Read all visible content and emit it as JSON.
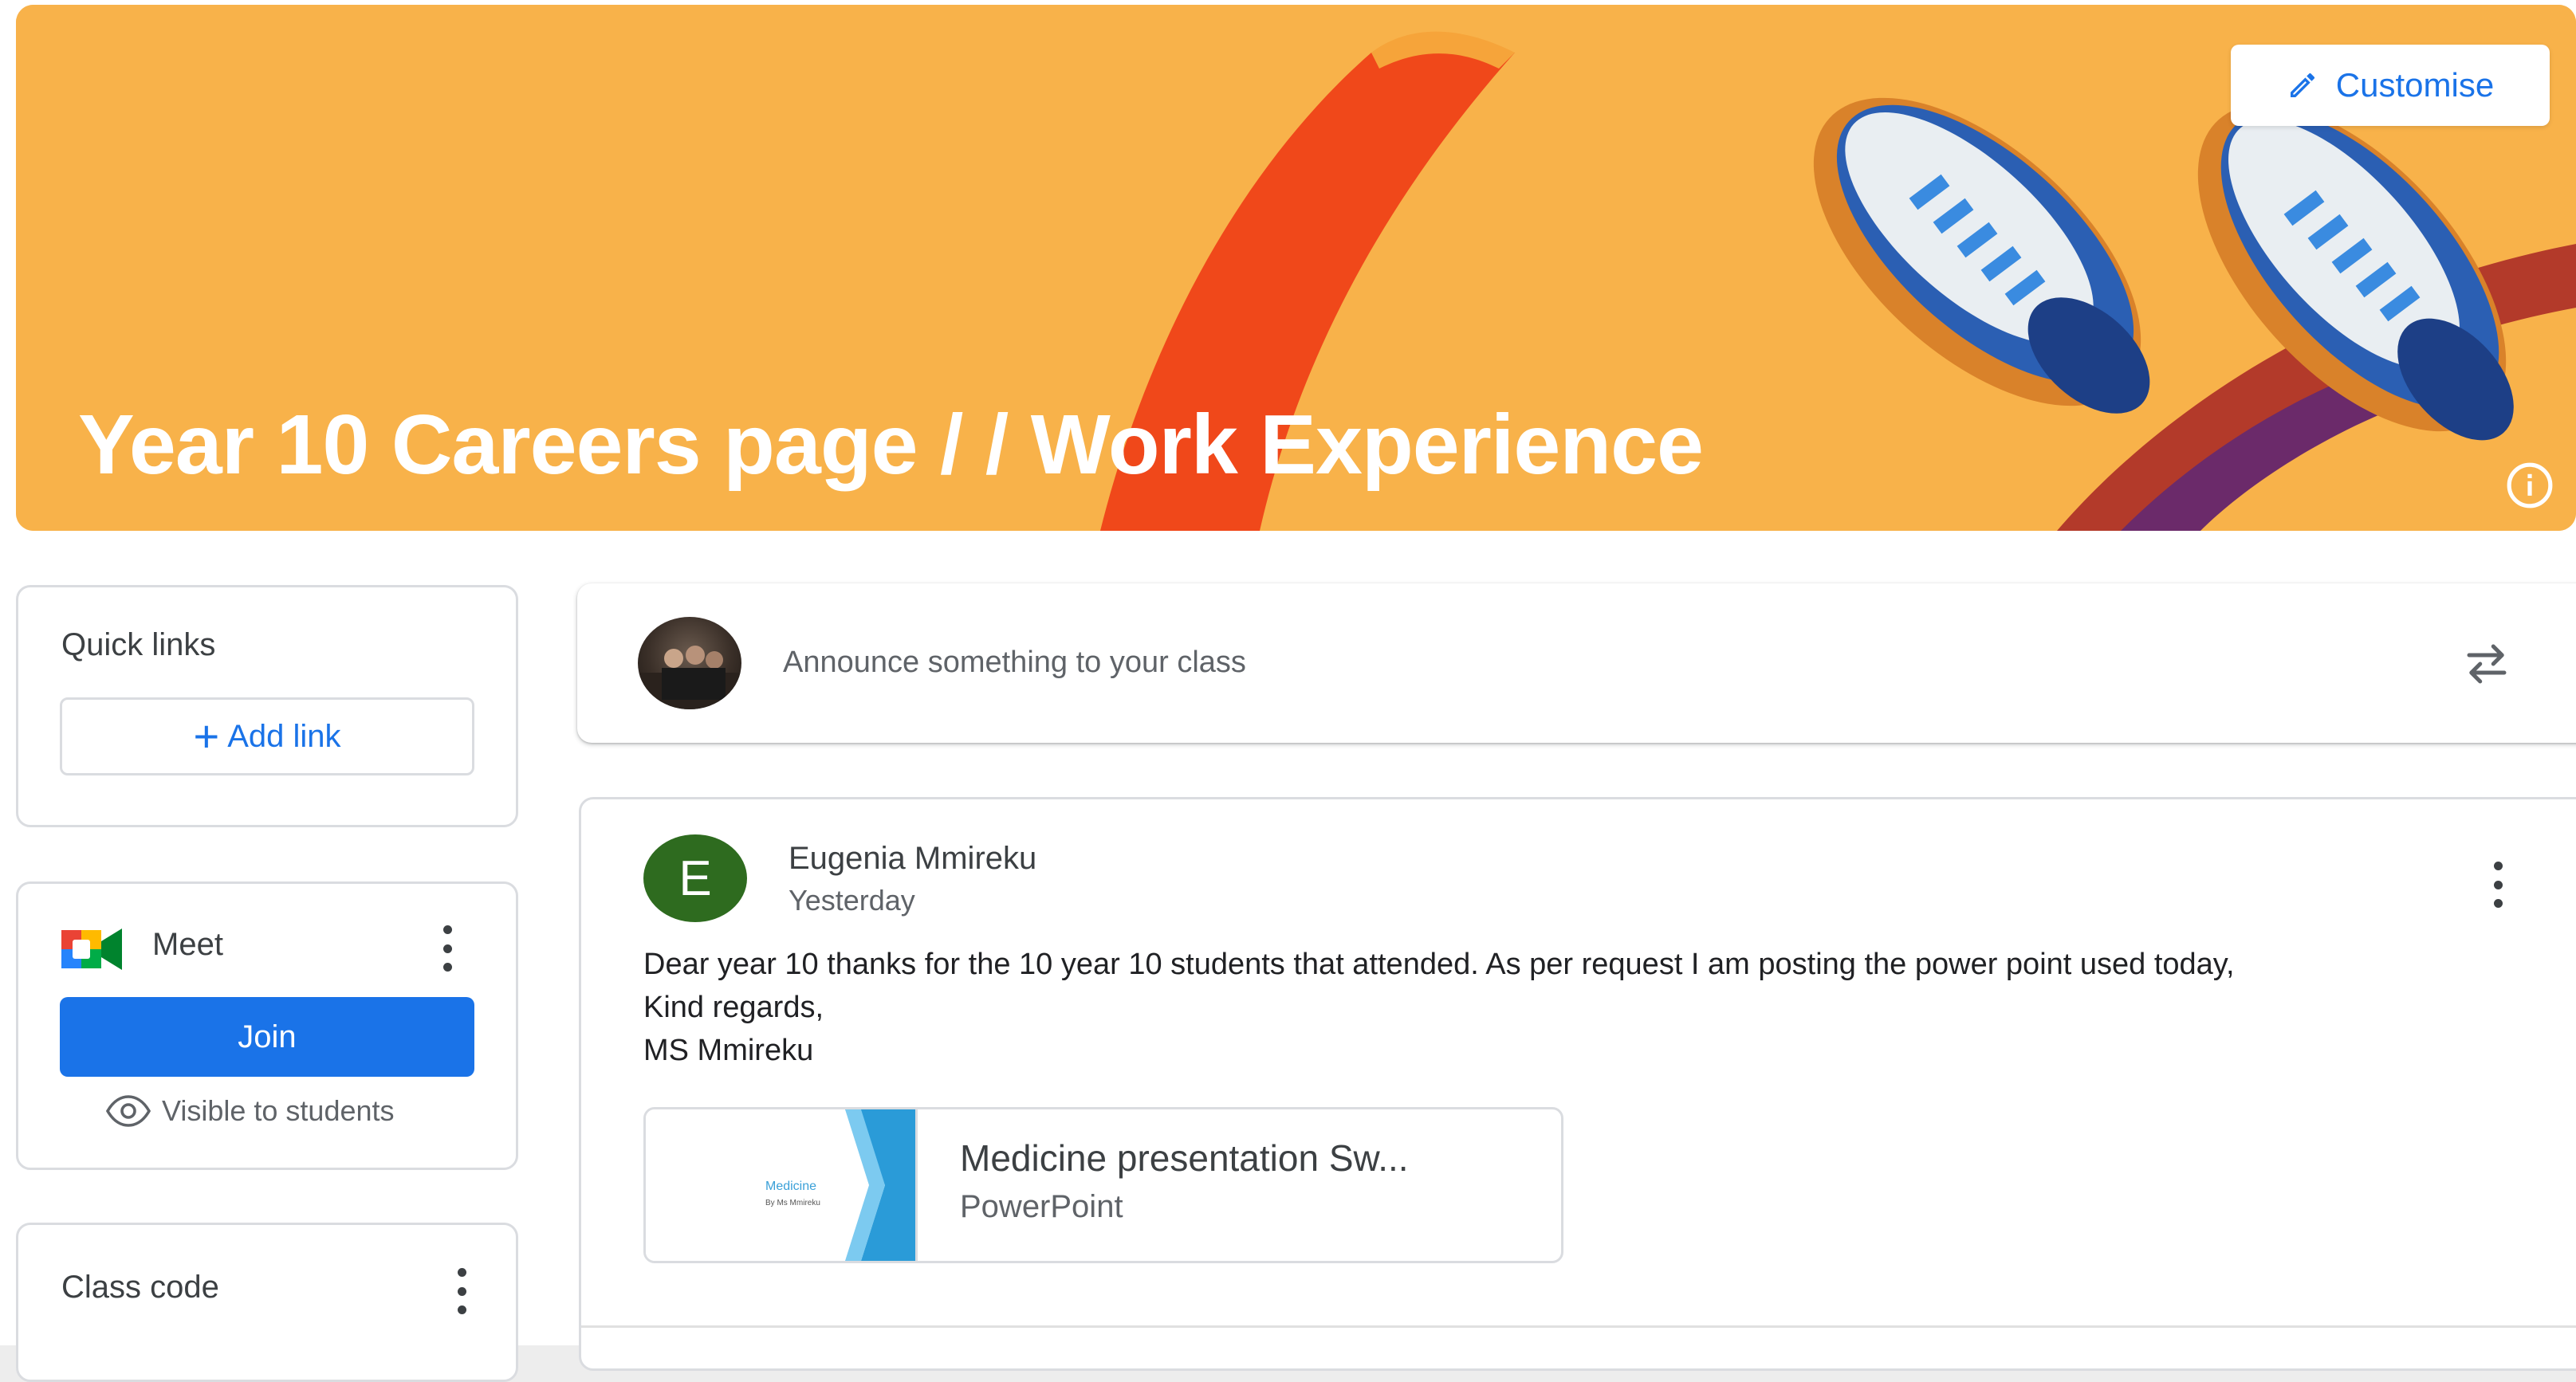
{
  "banner": {
    "title": "Year 10 Careers page / / Work Experience",
    "customise_label": "Customise",
    "colors": {
      "background": "#f8b24a",
      "accent": "#1a73e8"
    }
  },
  "quick_links": {
    "title": "Quick links",
    "add_link_label": "Add link",
    "add_icon": "plus-icon"
  },
  "meet": {
    "title": "Meet",
    "join_label": "Join",
    "visibility_label": "Visible to students",
    "join_color": "#1a73e8"
  },
  "class_code": {
    "title": "Class code"
  },
  "announce": {
    "placeholder": "Announce something to your class",
    "repost_icon": "repost-icon"
  },
  "post": {
    "avatar_letter": "E",
    "author": "Eugenia Mmireku",
    "time": "Yesterday",
    "body_lines": [
      "Dear year 10 thanks for the 10 year 10 students that attended. As per request I am posting the power point used today,",
      "Kind regards,",
      "MS Mmireku"
    ],
    "attachment": {
      "title": "Medicine presentation Sw...",
      "type": "PowerPoint",
      "thumb_title": "Medicine",
      "thumb_subtitle": "By Ms Mmireku"
    }
  }
}
